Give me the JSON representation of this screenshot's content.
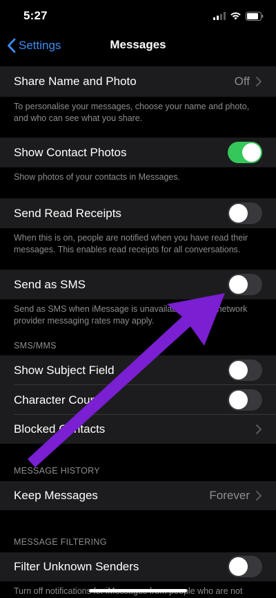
{
  "status_bar": {
    "time": "5:27"
  },
  "nav": {
    "back_label": "Settings",
    "title": "Messages"
  },
  "rows": {
    "share_name": {
      "label": "Share Name and Photo",
      "value": "Off"
    },
    "share_name_note": "To personalise your messages, choose your name and photo, and who can see what you share.",
    "show_contact_photos": {
      "label": "Show Contact Photos",
      "on": true
    },
    "show_contact_photos_note": "Show photos of your contacts in Messages.",
    "send_read_receipts": {
      "label": "Send Read Receipts",
      "on": false
    },
    "send_read_receipts_note": "When this is on, people are notified when you have read their messages. This enables read receipts for all conversations.",
    "send_as_sms": {
      "label": "Send as SMS",
      "on": false
    },
    "send_as_sms_note": "Send as SMS when iMessage is unavailable. Carrier network provider messaging rates may apply.",
    "show_subject_field": {
      "label": "Show Subject Field",
      "on": false
    },
    "character_count": {
      "label": "Character Count",
      "on": false
    },
    "blocked_contacts": {
      "label": "Blocked Contacts"
    },
    "keep_messages": {
      "label": "Keep Messages",
      "value": "Forever"
    },
    "filter_unknown_senders": {
      "label": "Filter Unknown Senders",
      "on": false
    },
    "filter_unknown_note": "Turn off notifications for iMessages from people who are not"
  },
  "sections": {
    "sms_mms": "SMS/MMS",
    "message_history": "MESSAGE HISTORY",
    "message_filtering": "MESSAGE FILTERING"
  },
  "colors": {
    "background": "#000000",
    "cell": "#1c1c1e",
    "accent_blue": "#3d8ef6",
    "toggle_on": "#34c759",
    "toggle_off": "#39393d",
    "secondary_text": "#8e8e93",
    "annotation_arrow": "#7a1fd1"
  }
}
